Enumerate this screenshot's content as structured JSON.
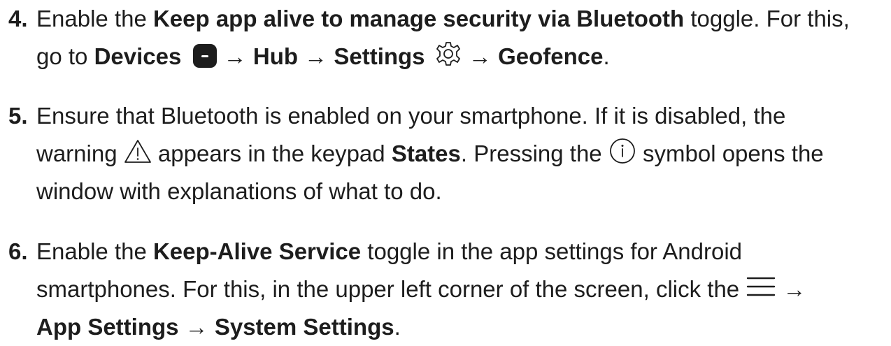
{
  "steps": [
    {
      "number": "4.",
      "line1": {
        "t1": "Enable the ",
        "b1": "Keep app alive to manage security via Bluetooth",
        "t2": " toggle. For this,"
      },
      "line2": {
        "t1": "go to ",
        "b1": "Devices",
        "arrow1": " → ",
        "b2": "Hub",
        "arrow2": " → ",
        "b3": "Settings",
        "arrow3": " → ",
        "b4": "Geofence",
        "t2": "."
      }
    },
    {
      "number": "5.",
      "line1": {
        "t1": "Ensure that Bluetooth is enabled on your smartphone. If it is disabled, the"
      },
      "line2": {
        "t1": "warning ",
        "t2": " appears in the keypad ",
        "b1": "States",
        "t3": ". Pressing the ",
        "t4": " symbol opens the"
      },
      "line3": {
        "t1": "window with explanations of what to do."
      }
    },
    {
      "number": "6.",
      "line1": {
        "t1": "Enable the ",
        "b1": "Keep-Alive Service",
        "t2": " toggle in the app settings for Android"
      },
      "line2": {
        "t1": "smartphones. For this, in the upper left corner of the screen, click the ",
        "arrow1": " →"
      },
      "line3": {
        "b1": "App Settings",
        "arrow1": " → ",
        "b2": "System Settings",
        "t1": "."
      }
    }
  ],
  "colors": {
    "text": "#1d1d1d",
    "icon_fill": "#1d1d1d",
    "background": "#ffffff"
  },
  "icons": [
    "devices-tile-icon",
    "gear-icon",
    "warning-triangle-icon",
    "info-circle-icon",
    "hamburger-menu-icon"
  ]
}
